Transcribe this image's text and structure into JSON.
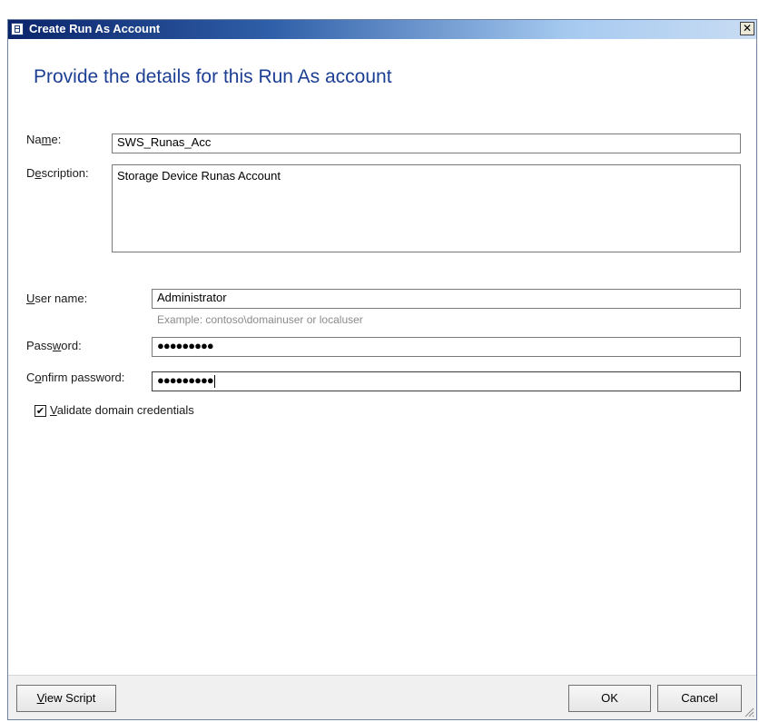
{
  "window": {
    "title": "Create Run As Account",
    "close_glyph": "✕"
  },
  "heading": "Provide the details for this Run As account",
  "form": {
    "name": {
      "label_pre": "Na",
      "label_accel": "m",
      "label_post": "e:",
      "value": "SWS_Runas_Acc"
    },
    "description": {
      "label_pre": "D",
      "label_accel": "e",
      "label_post": "scription:",
      "value": "Storage Device Runas Account"
    },
    "username": {
      "label_pre": "",
      "label_accel": "U",
      "label_post": "ser name:",
      "value": "Administrator",
      "hint": "Example: contoso\\domainuser or localuser"
    },
    "password": {
      "label_pre": "Pass",
      "label_accel": "w",
      "label_post": "ord:",
      "value": "●●●●●●●●●"
    },
    "confirm_password": {
      "label_pre": "C",
      "label_accel": "o",
      "label_post": "nfirm password:",
      "value": "●●●●●●●●●"
    },
    "validate": {
      "checked": true,
      "check_glyph": "✔",
      "label_pre": "",
      "label_accel": "V",
      "label_post": "alidate domain credentials"
    }
  },
  "footer": {
    "view_script": {
      "label_pre": "",
      "label_accel": "V",
      "label_post": "iew Script"
    },
    "ok_label": "OK",
    "cancel_label": "Cancel"
  }
}
